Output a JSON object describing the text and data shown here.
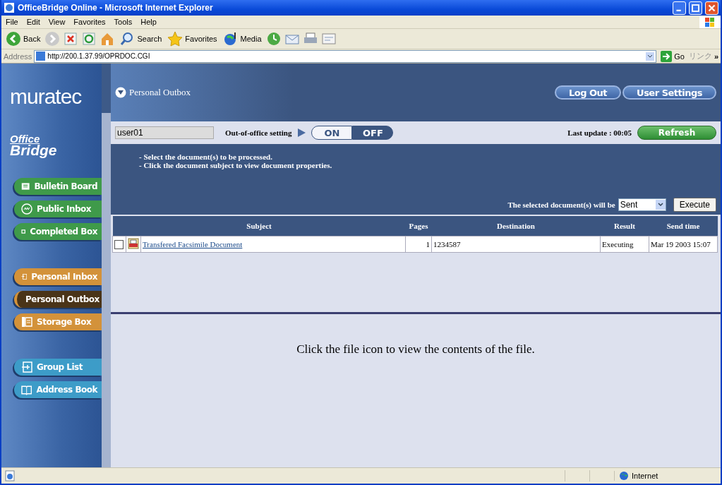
{
  "window": {
    "title": "OfficeBridge Online - Microsoft Internet Explorer"
  },
  "menu": [
    "File",
    "Edit",
    "View",
    "Favorites",
    "Tools",
    "Help"
  ],
  "toolbar": [
    {
      "kind": "back",
      "label": "Back"
    },
    {
      "kind": "forward"
    },
    {
      "kind": "stop"
    },
    {
      "kind": "refresh"
    },
    {
      "kind": "home"
    },
    {
      "kind": "search",
      "label": "Search"
    },
    {
      "kind": "favorites",
      "label": "Favorites"
    },
    {
      "kind": "media",
      "label": "Media"
    },
    {
      "kind": "history"
    },
    {
      "kind": "mail"
    },
    {
      "kind": "print"
    },
    {
      "kind": "edit"
    }
  ],
  "address": {
    "label": "Address",
    "url": "http://200.1.37.99/OPRDOC.CGI",
    "go": "Go",
    "links": "リンク",
    "more": "»"
  },
  "brand": {
    "name": "muratec",
    "product_line1": "Office",
    "product_line2": "Bridge"
  },
  "sidebar": {
    "groups": [
      [
        {
          "label": "Bulletin Board",
          "color": "#3f9a4a",
          "selected": false
        },
        {
          "label": "Public Inbox",
          "color": "#3f9a4a",
          "selected": false
        },
        {
          "label": "Completed Box",
          "color": "#3f9a4a",
          "selected": false
        }
      ],
      [
        {
          "label": "Personal Inbox",
          "color": "#d3923a",
          "selected": false
        },
        {
          "label": "Personal Outbox",
          "color": "#d3923a",
          "selected": true
        },
        {
          "label": "Storage Box",
          "color": "#d3923a",
          "selected": false
        }
      ],
      [
        {
          "label": "Group List",
          "color": "#3d9cc8",
          "selected": false
        },
        {
          "label": "Address Book",
          "color": "#3d9cc8",
          "selected": false
        }
      ]
    ]
  },
  "page": {
    "title": "Personal Outbox",
    "buttons": [
      "Log Out",
      "User Settings"
    ],
    "user": "user01",
    "out_of_office_label": "Out-of-office setting",
    "out_of_office": [
      {
        "label": "ON",
        "selected": false
      },
      {
        "label": "OFF",
        "selected": true
      }
    ],
    "last_update": "Last update : 00:05",
    "refresh": "Refresh",
    "instructions": [
      "- Select the document(s) to be processed.",
      "- Click the document subject to view document properties."
    ],
    "action_label": "The selected document(s) will be",
    "action_value": "Sent",
    "execute": "Execute"
  },
  "table": {
    "columns": [
      "Subject",
      "Pages",
      "Destination",
      "Result",
      "Send time"
    ],
    "rows": [
      {
        "checked": false,
        "subject": "Transfered Facsimile Document",
        "pages": "1",
        "destination": "1234587",
        "result": "Executing",
        "send_time": "Mar 19 2003 15:07"
      }
    ]
  },
  "message": "Click the file icon to view the contents of the file.",
  "status_bar": {
    "zone": "Internet"
  }
}
